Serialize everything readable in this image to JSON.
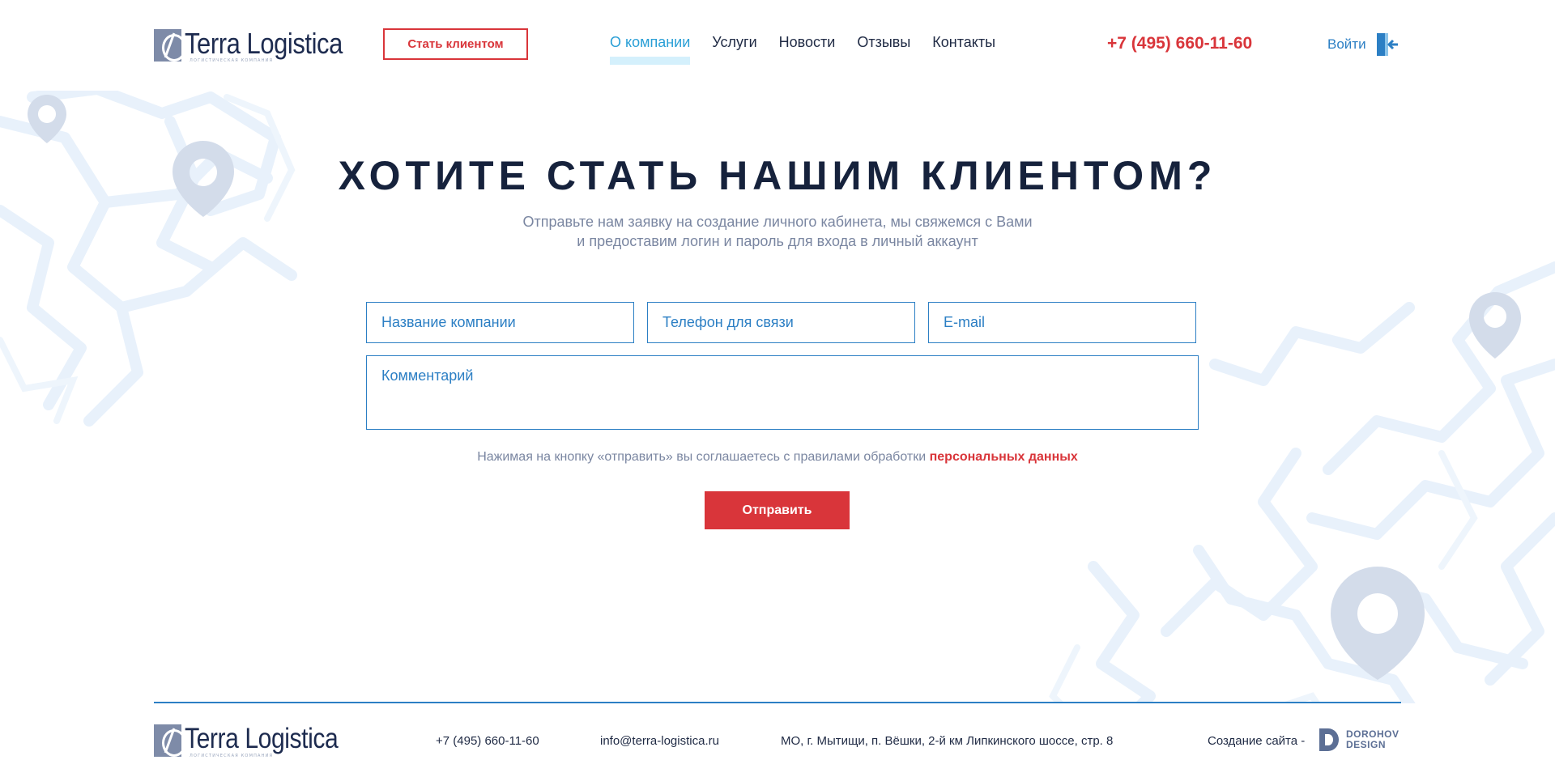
{
  "brand": {
    "name": "Terra Logistica",
    "tagline": "логистическая компания"
  },
  "header": {
    "cta_label": "Стать клиентом",
    "nav": [
      {
        "label": "О компании",
        "active": true
      },
      {
        "label": "Услуги",
        "active": false
      },
      {
        "label": "Новости",
        "active": false
      },
      {
        "label": "Отзывы",
        "active": false
      },
      {
        "label": "Контакты",
        "active": false
      }
    ],
    "phone": "+7 (495) 660-11-60",
    "login_label": "Войти",
    "login_icon": "login-door-icon"
  },
  "main": {
    "title": "ХОТИТЕ СТАТЬ НАШИМ КЛИЕНТОМ?",
    "subtitle_line1": "Отправьте нам заявку на создание личного кабинета, мы свяжемся с Вами",
    "subtitle_line2": "и предоставим логин и пароль для входа в личный аккаунт",
    "form": {
      "company_placeholder": "Название компании",
      "phone_placeholder": "Телефон для связи",
      "email_placeholder": "E-mail",
      "comment_placeholder": "Комментарий"
    },
    "agree_text": "Нажимая на кнопку «отправить» вы соглашаетесь с правилами обработки",
    "agree_link": "персональных данных",
    "submit_label": "Отправить"
  },
  "footer": {
    "phone": "+7 (495) 660-11-60",
    "email": "info@terra-logistica.ru",
    "address": "МО, г. Мытищи, п. Вёшки, 2-й км Липкинского шоссе, стр. 8",
    "made_by_label": "Создание сайта -",
    "studio_line1": "DOROHOV",
    "studio_line2": "DESIGN"
  },
  "colors": {
    "accent_red": "#d9353a",
    "accent_blue": "#2c7fc4",
    "nav_active": "#2a9fd6",
    "title": "#16223c",
    "pin": "#d3dcea"
  }
}
